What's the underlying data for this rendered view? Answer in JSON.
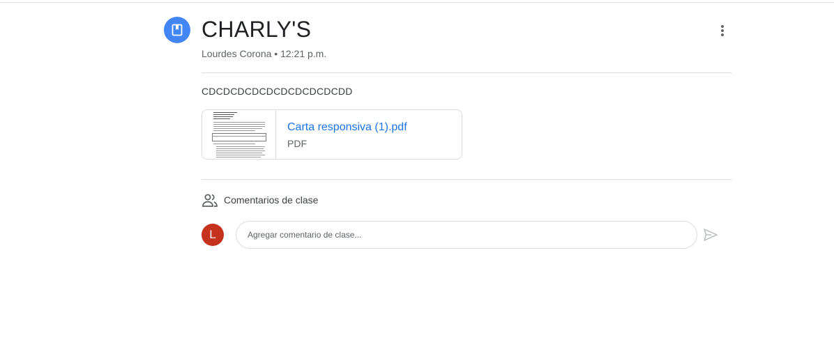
{
  "post": {
    "icon": "assignment-book-icon",
    "title": "CHARLY'S",
    "author": "Lourdes Corona",
    "separator": "•",
    "time": "12:21 p.m.",
    "meta": "Lourdes Corona • 12:21 p.m.",
    "body": "CDCDCDCDCDCDCDCDCDCDD",
    "more_icon": "more-vert-icon"
  },
  "attachment": {
    "name": "Carta responsiva (1).pdf",
    "type": "PDF"
  },
  "comments": {
    "icon": "people-icon",
    "label": "Comentarios de clase",
    "avatar_initial": "L",
    "input_placeholder": "Agregar comentario de clase...",
    "send_icon": "send-icon"
  },
  "colors": {
    "accent": "#4285f4",
    "link": "#1a73e8",
    "avatar": "#c5321d"
  }
}
